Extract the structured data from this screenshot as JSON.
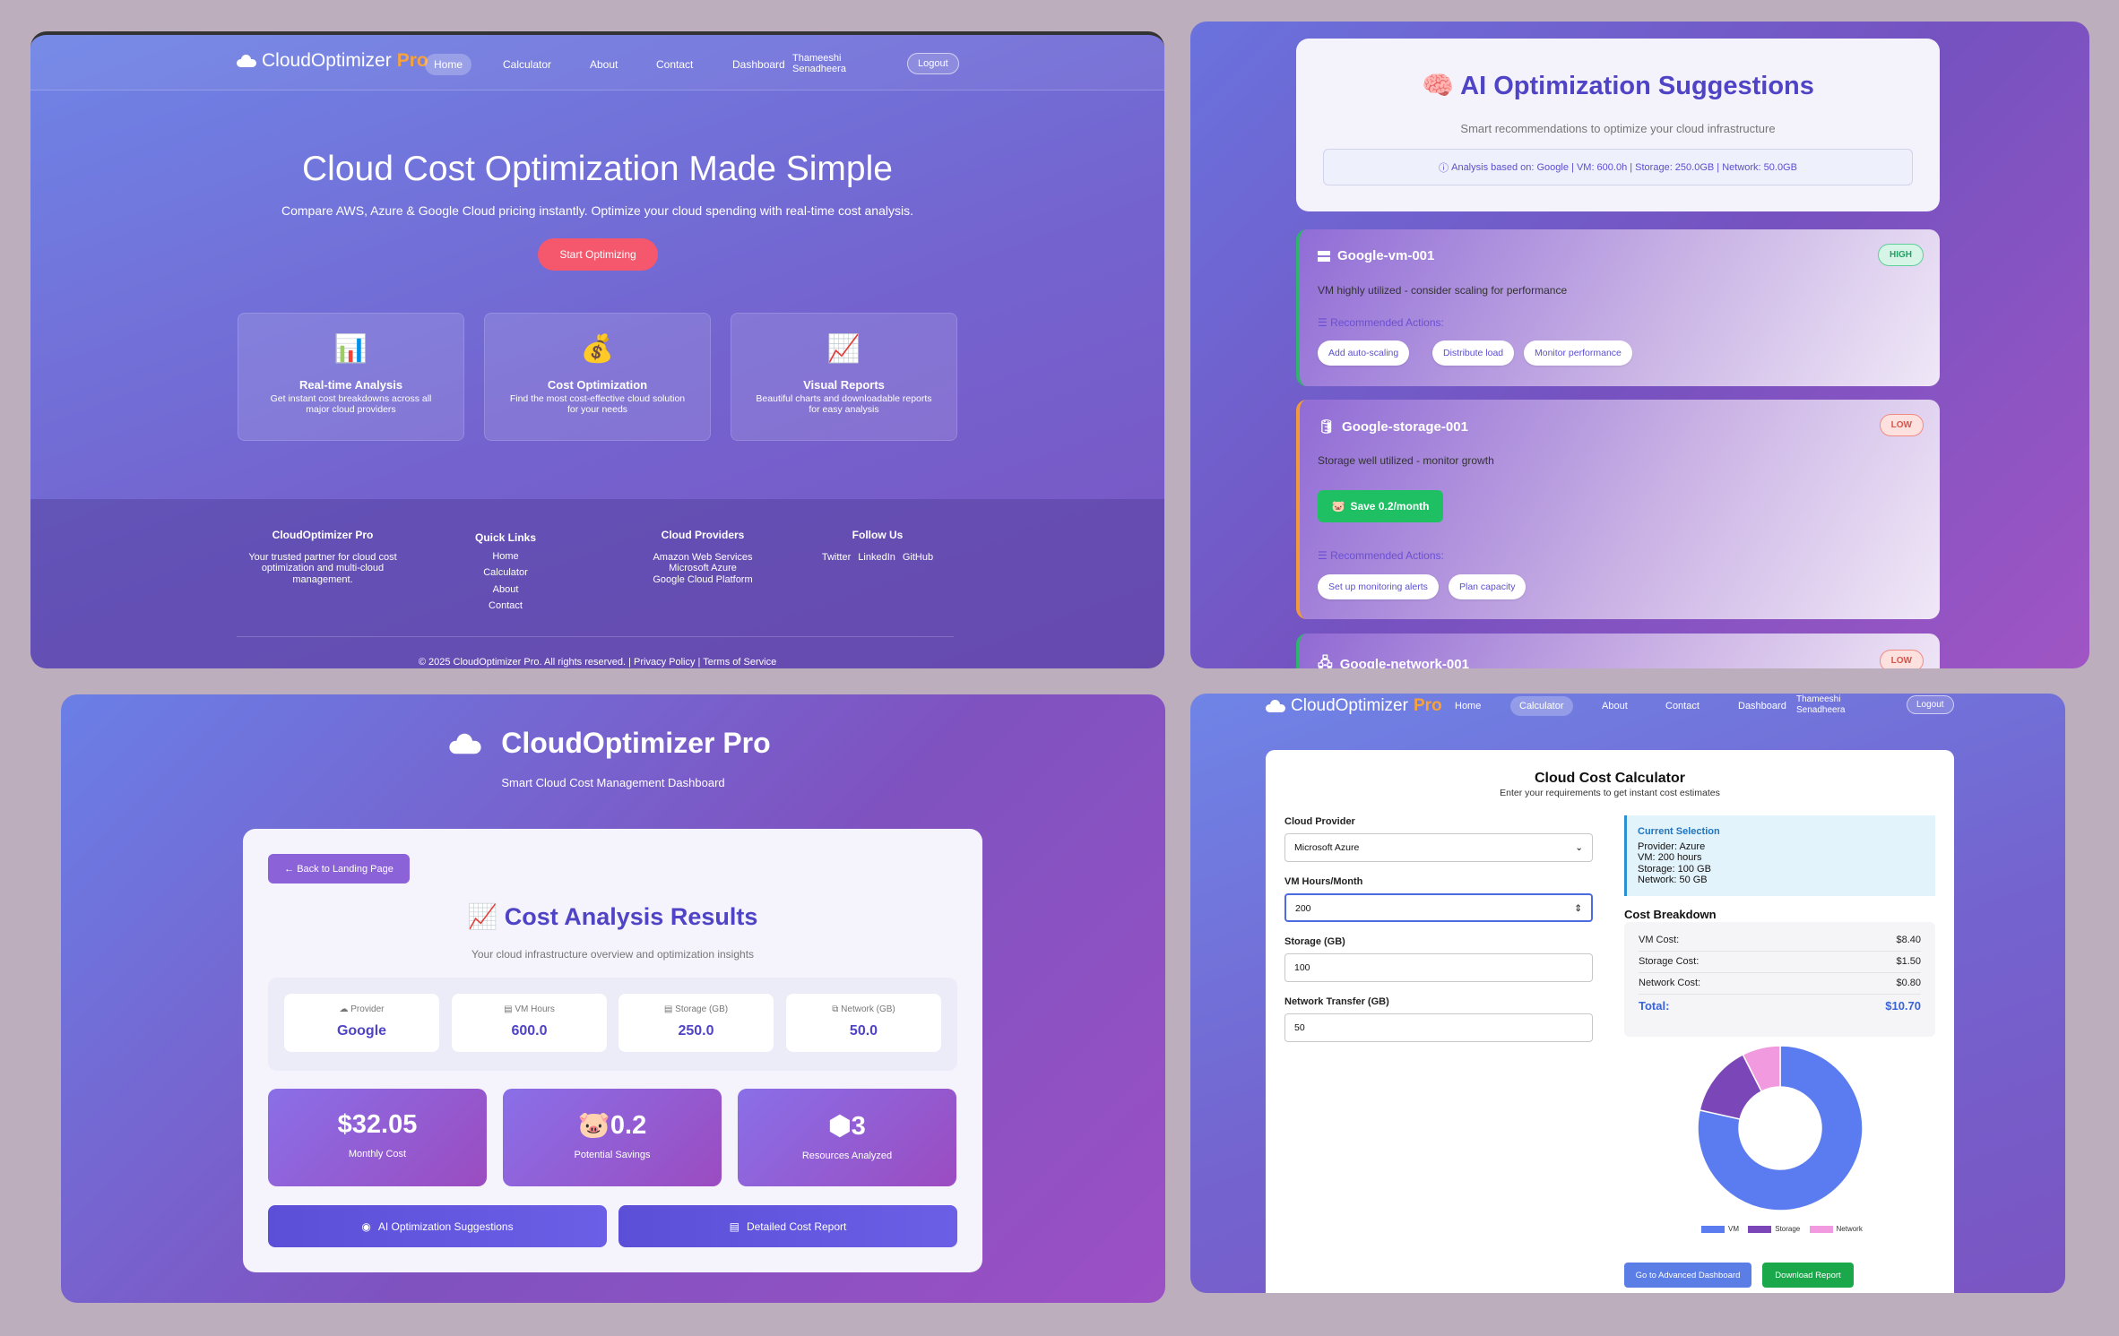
{
  "landing": {
    "logo": {
      "name": "CloudOptimizer",
      "pro": "Pro"
    },
    "nav": [
      "Home",
      "Calculator",
      "About",
      "Contact",
      "Dashboard"
    ],
    "user": [
      "Thameeshi",
      "Senadheera"
    ],
    "logout": "Logout",
    "hero_title": "Cloud Cost Optimization Made Simple",
    "hero_subtitle": "Compare AWS, Azure & Google Cloud pricing instantly. Optimize your cloud spending with real-time cost analysis.",
    "cta": "Start Optimizing",
    "features": [
      {
        "icon": "📊",
        "icon_name": "bar-chart-icon",
        "title": "Real-time Analysis",
        "desc": "Get instant cost breakdowns across all major cloud providers"
      },
      {
        "icon": "💰",
        "icon_name": "money-bag-icon",
        "title": "Cost Optimization",
        "desc": "Find the most cost-effective cloud solution for your needs"
      },
      {
        "icon": "📈",
        "icon_name": "trend-chart-icon",
        "title": "Visual Reports",
        "desc": "Beautiful charts and downloadable reports for easy analysis"
      }
    ],
    "footer": {
      "brand": "CloudOptimizer Pro",
      "brand_desc": "Your trusted partner for cloud cost optimization and multi-cloud management.",
      "quick_links_title": "Quick Links",
      "quick_links": [
        "Home",
        "Calculator",
        "About",
        "Contact"
      ],
      "providers_title": "Cloud Providers",
      "providers": [
        "Amazon Web Services",
        "Microsoft Azure",
        "Google Cloud Platform"
      ],
      "follow_title": "Follow Us",
      "social": [
        "Twitter",
        "LinkedIn",
        "GitHub"
      ],
      "copyright": "© 2025 CloudOptimizer Pro. All rights reserved. | Privacy Policy | Terms of Service"
    }
  },
  "suggestions": {
    "title": "AI Optimization Suggestions",
    "subtitle": "Smart recommendations to optimize your cloud infrastructure",
    "analysis": "Analysis based on: Google | VM: 600.0h | Storage: 250.0GB | Network: 50.0GB",
    "recommended_label": "Recommended Actions:",
    "cards": [
      {
        "name": "Google-vm-001",
        "priority": "HIGH",
        "desc": "VM highly utilized - consider scaling for performance",
        "actions": [
          "Add auto-scaling",
          "Distribute load",
          "Monitor performance"
        ]
      },
      {
        "name": "Google-storage-001",
        "priority": "LOW",
        "desc": "Storage well utilized - monitor growth",
        "save": "Save 0.2/month",
        "actions": [
          "Set up monitoring alerts",
          "Plan capacity"
        ]
      },
      {
        "name": "Google-network-001",
        "priority": "LOW"
      }
    ]
  },
  "dashboard": {
    "brand": "CloudOptimizer Pro",
    "subtitle": "Smart Cloud Cost Management Dashboard",
    "back": "Back to Landing Page",
    "title": "Cost Analysis Results",
    "desc": "Your cloud infrastructure overview and optimization insights",
    "stats": [
      {
        "label": "Provider",
        "value": "Google"
      },
      {
        "label": "VM Hours",
        "value": "600.0"
      },
      {
        "label": "Storage (GB)",
        "value": "250.0"
      },
      {
        "label": "Network (GB)",
        "value": "50.0"
      }
    ],
    "metrics": [
      {
        "value": "$32.05",
        "label": "Monthly Cost"
      },
      {
        "value": "0.2",
        "label": "Potential Savings"
      },
      {
        "value": "3",
        "label": "Resources Analyzed"
      }
    ],
    "actions": [
      "AI Optimization Suggestions",
      "Detailed Cost Report"
    ]
  },
  "calculator": {
    "logo": {
      "name": "CloudOptimizer",
      "pro": "Pro"
    },
    "nav": [
      "Home",
      "Calculator",
      "About",
      "Contact",
      "Dashboard"
    ],
    "user": [
      "Thameeshi",
      "Senadheera"
    ],
    "logout": "Logout",
    "title": "Cloud Cost Calculator",
    "subtitle": "Enter your requirements to get instant cost estimates",
    "provider_label": "Cloud Provider",
    "provider_value": "Microsoft Azure",
    "vm_label": "VM Hours/Month",
    "vm_value": "200",
    "storage_label": "Storage (GB)",
    "storage_value": "100",
    "network_label": "Network Transfer (GB)",
    "network_value": "50",
    "selection": {
      "title": "Current Selection",
      "lines": [
        "Provider: Azure",
        "VM: 200 hours",
        "Storage: 100 GB",
        "Network: 50 GB"
      ]
    },
    "breakdown_title": "Cost Breakdown",
    "breakdown": [
      {
        "label": "VM Cost:",
        "value": "$8.40"
      },
      {
        "label": "Storage Cost:",
        "value": "$1.50"
      },
      {
        "label": "Network Cost:",
        "value": "$0.80"
      }
    ],
    "total_label": "Total:",
    "total_value": "$10.70",
    "chart_data": {
      "type": "pie",
      "categories": [
        "VM",
        "Storage",
        "Network"
      ],
      "values": [
        8.4,
        1.5,
        0.8
      ],
      "colors": [
        "#5b7cf0",
        "#7b47b8",
        "#f29ae0"
      ],
      "legend": "bottom"
    },
    "buttons": [
      "Go to Advanced Dashboard",
      "Download Report"
    ]
  }
}
